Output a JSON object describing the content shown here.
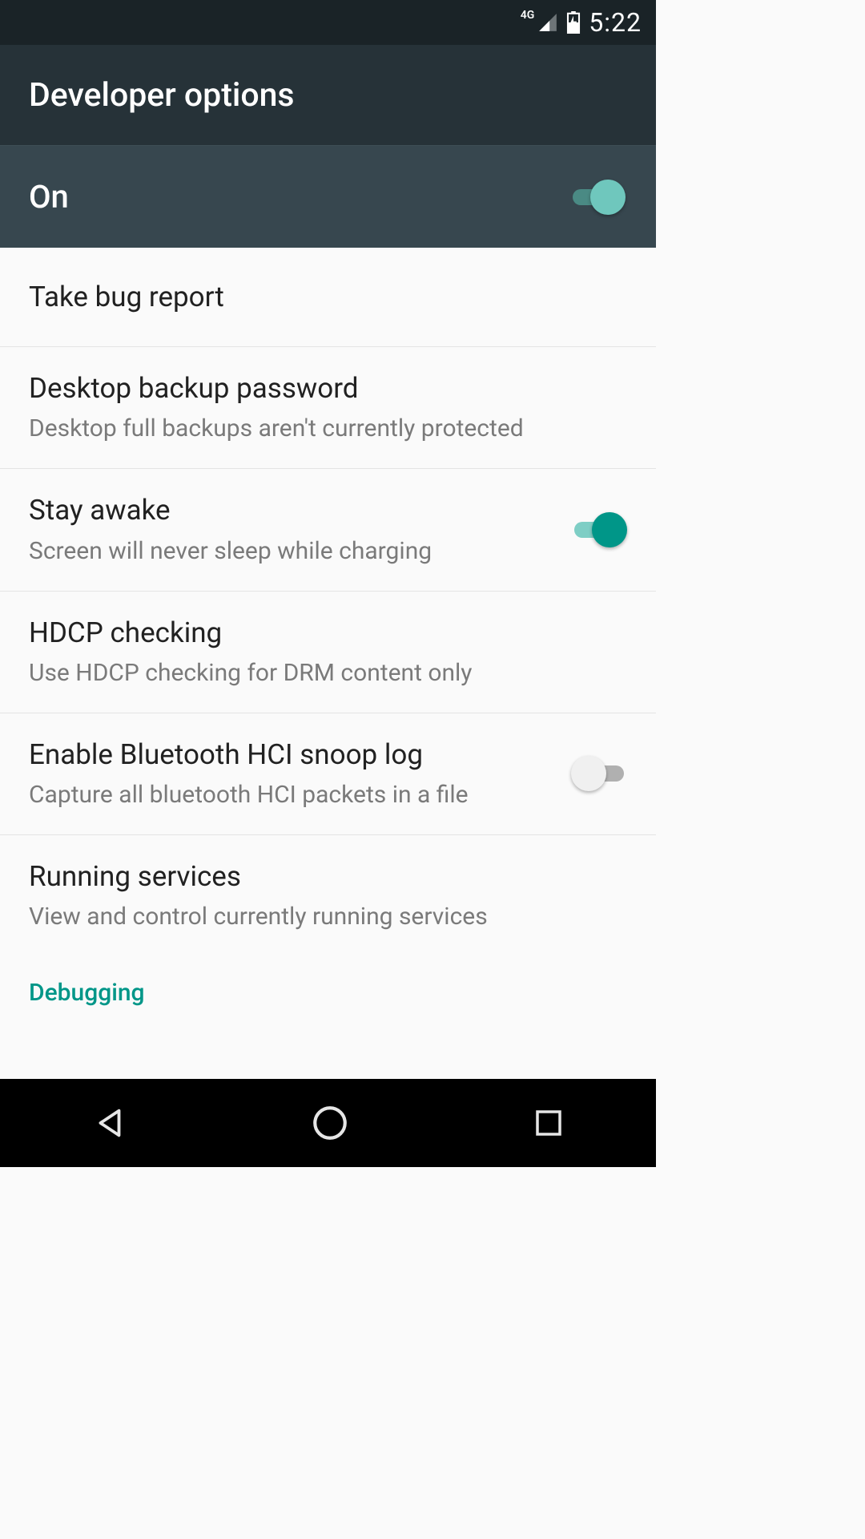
{
  "status_bar": {
    "network_label": "4G",
    "time": "5:22"
  },
  "app_bar": {
    "title": "Developer options"
  },
  "master": {
    "label": "On",
    "enabled": true
  },
  "items": [
    {
      "title": "Take bug report",
      "subtitle": null,
      "has_switch": false
    },
    {
      "title": "Desktop backup password",
      "subtitle": "Desktop full backups aren't currently protected",
      "has_switch": false
    },
    {
      "title": "Stay awake",
      "subtitle": "Screen will never sleep while charging",
      "has_switch": true,
      "switch_on": true
    },
    {
      "title": "HDCP checking",
      "subtitle": "Use HDCP checking for DRM content only",
      "has_switch": false
    },
    {
      "title": "Enable Bluetooth HCI snoop log",
      "subtitle": "Capture all bluetooth HCI packets in a file",
      "has_switch": true,
      "switch_on": false
    },
    {
      "title": "Running services",
      "subtitle": "View and control currently running services",
      "has_switch": false
    }
  ],
  "section_header": "Debugging",
  "colors": {
    "accent": "#009688",
    "header_bg": "#263238",
    "subheader_bg": "#37474f",
    "status_bg": "#1a2327"
  }
}
